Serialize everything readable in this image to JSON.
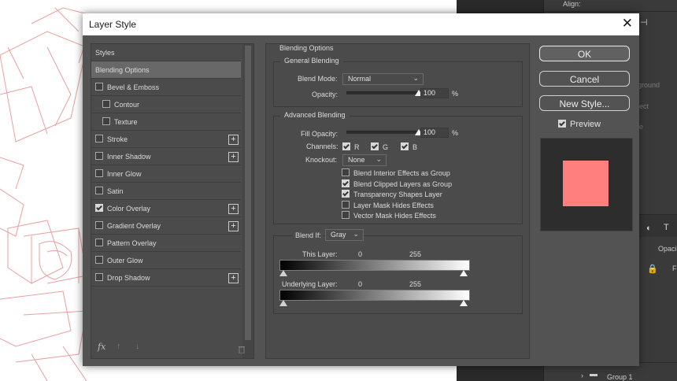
{
  "dialog": {
    "title": "Layer Style",
    "close": "✕"
  },
  "style_list": {
    "items": [
      {
        "label": "Styles",
        "checkbox": false,
        "selected": false,
        "indent": false,
        "plus": false
      },
      {
        "label": "Blending Options",
        "checkbox": false,
        "selected": true,
        "indent": false,
        "plus": false
      },
      {
        "label": "Bevel & Emboss",
        "checkbox": true,
        "checked": false,
        "selected": false,
        "indent": false,
        "plus": false
      },
      {
        "label": "Contour",
        "checkbox": true,
        "checked": false,
        "selected": false,
        "indent": true,
        "plus": false
      },
      {
        "label": "Texture",
        "checkbox": true,
        "checked": false,
        "selected": false,
        "indent": true,
        "plus": false
      },
      {
        "label": "Stroke",
        "checkbox": true,
        "checked": false,
        "selected": false,
        "indent": false,
        "plus": true
      },
      {
        "label": "Inner Shadow",
        "checkbox": true,
        "checked": false,
        "selected": false,
        "indent": false,
        "plus": true
      },
      {
        "label": "Inner Glow",
        "checkbox": true,
        "checked": false,
        "selected": false,
        "indent": false,
        "plus": false
      },
      {
        "label": "Satin",
        "checkbox": true,
        "checked": false,
        "selected": false,
        "indent": false,
        "plus": false
      },
      {
        "label": "Color Overlay",
        "checkbox": true,
        "checked": true,
        "selected": false,
        "indent": false,
        "plus": true
      },
      {
        "label": "Gradient Overlay",
        "checkbox": true,
        "checked": false,
        "selected": false,
        "indent": false,
        "plus": true
      },
      {
        "label": "Pattern Overlay",
        "checkbox": true,
        "checked": false,
        "selected": false,
        "indent": false,
        "plus": false
      },
      {
        "label": "Outer Glow",
        "checkbox": true,
        "checked": false,
        "selected": false,
        "indent": false,
        "plus": false
      },
      {
        "label": "Drop Shadow",
        "checkbox": true,
        "checked": false,
        "selected": false,
        "indent": false,
        "plus": true
      }
    ],
    "footer": {
      "fx": "fx",
      "up": "↑",
      "down": "↓",
      "trash": "trash-icon"
    }
  },
  "blending": {
    "section_title": "Blending Options",
    "general": {
      "title": "General Blending",
      "blend_mode_label": "Blend Mode:",
      "blend_mode_value": "Normal",
      "opacity_label": "Opacity:",
      "opacity_value": "100",
      "opacity_pct": 1.0,
      "unit": "%"
    },
    "advanced": {
      "title": "Advanced Blending",
      "fill_opacity_label": "Fill Opacity:",
      "fill_opacity_value": "100",
      "fill_opacity_pct": 1.0,
      "unit": "%",
      "channels_label": "Channels:",
      "channels": [
        {
          "label": "R",
          "checked": true
        },
        {
          "label": "G",
          "checked": true
        },
        {
          "label": "B",
          "checked": true
        }
      ],
      "knockout_label": "Knockout:",
      "knockout_value": "None",
      "options": [
        {
          "label": "Blend Interior Effects as Group",
          "checked": false
        },
        {
          "label": "Blend Clipped Layers as Group",
          "checked": true
        },
        {
          "label": "Transparency Shapes Layer",
          "checked": true
        },
        {
          "label": "Layer Mask Hides Effects",
          "checked": false
        },
        {
          "label": "Vector Mask Hides Effects",
          "checked": false
        }
      ]
    },
    "blend_if": {
      "label": "Blend If:",
      "value": "Gray",
      "this_layer_label": "This Layer:",
      "this_layer_low": "0",
      "this_layer_high": "255",
      "underlying_label": "Underlying Layer:",
      "underlying_low": "0",
      "underlying_high": "255"
    }
  },
  "buttons": {
    "ok": "OK",
    "cancel": "Cancel",
    "new_style": "New Style...",
    "preview_label": "Preview",
    "preview_checked": true
  },
  "preview_color": "#ff7f7f",
  "right_panel": {
    "align_label": "Align:",
    "faded_ground": "ground",
    "faded_ject": "ject",
    "faded_e": "e",
    "opacity_label": "Opaci",
    "layer_name": "Group 1",
    "fill_short": "Fi"
  }
}
